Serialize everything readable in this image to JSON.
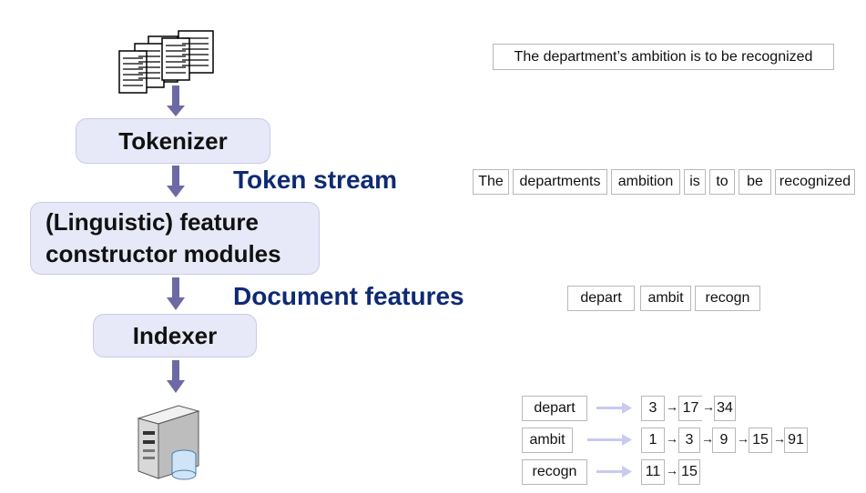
{
  "stages": {
    "tokenizer": "Tokenizer",
    "feature_line1": "(Linguistic) feature",
    "feature_line2": "constructor modules",
    "indexer": "Indexer"
  },
  "labels": {
    "token_stream": "Token stream",
    "document_features": "Document features"
  },
  "sentence": "The department’s ambition is to be recognized",
  "tokens": [
    "The",
    "departments",
    "ambition",
    "is",
    "to",
    "be",
    "recognized"
  ],
  "features": [
    "depart",
    "ambit",
    "recogn"
  ],
  "postings": [
    {
      "term": "depart",
      "ids": [
        "3",
        "17",
        "34"
      ]
    },
    {
      "term": "ambit",
      "ids": [
        "1",
        "3",
        "9",
        "15",
        "91"
      ]
    },
    {
      "term": "recogn",
      "ids": [
        "11",
        "15"
      ]
    }
  ],
  "icons": {
    "documents": "documents-stack-icon",
    "server": "database-server-icon"
  },
  "colors": {
    "stage_fill": "#e7e8f8",
    "label_blue": "#0f2a73",
    "flow_arrow": "#6b6aa4",
    "posting_arrow": "#c9c9f2"
  }
}
